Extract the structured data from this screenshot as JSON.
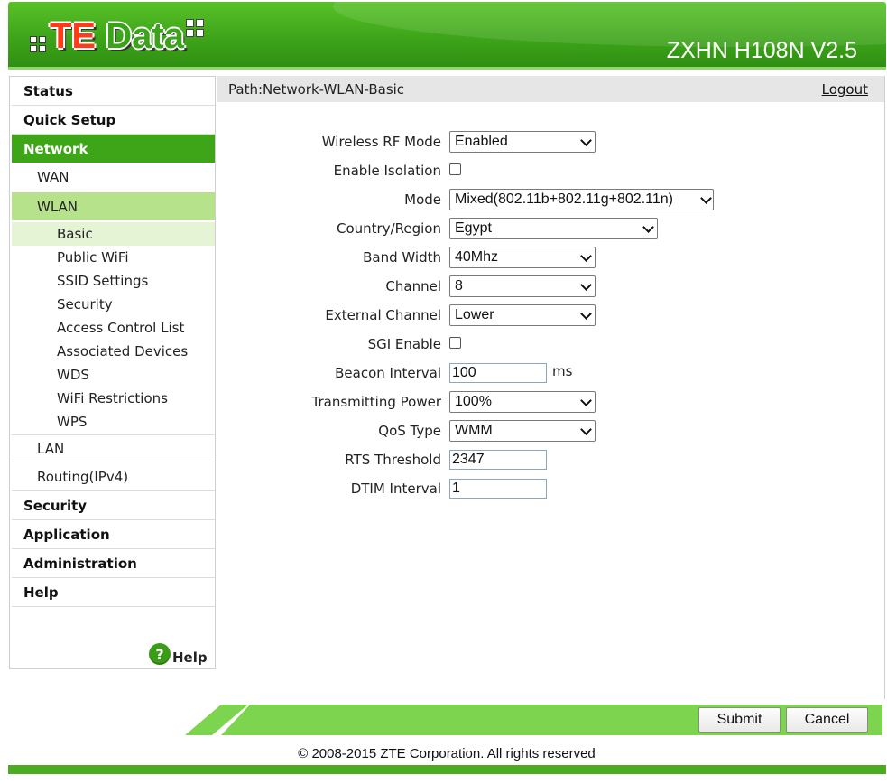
{
  "header": {
    "logo_text_part1": "TE",
    "logo_text_part2": "Data",
    "model": "ZXHN H108N V2.5"
  },
  "colors": {
    "brand_green": "#3ea518",
    "submenu_open": "#b6e28c",
    "submenu_current": "#e4f4d4",
    "logo_red": "#ff3c1a"
  },
  "sidebar": {
    "top_items": [
      {
        "label": "Status"
      },
      {
        "label": "Quick Setup"
      },
      {
        "label": "Network",
        "active": true
      }
    ],
    "network_subitems": [
      {
        "label": "WAN"
      },
      {
        "label": "WLAN",
        "open": true
      }
    ],
    "wlan_leaves": [
      {
        "label": "Basic",
        "current": true
      },
      {
        "label": "Public WiFi"
      },
      {
        "label": "SSID Settings"
      },
      {
        "label": "Security"
      },
      {
        "label": "Access Control List"
      },
      {
        "label": "Associated Devices"
      },
      {
        "label": "WDS"
      },
      {
        "label": "WiFi Restrictions"
      },
      {
        "label": "WPS"
      }
    ],
    "network_subitems_after": [
      {
        "label": "LAN"
      },
      {
        "label": "Routing(IPv4)"
      }
    ],
    "bottom_items": [
      {
        "label": "Security"
      },
      {
        "label": "Application"
      },
      {
        "label": "Administration"
      },
      {
        "label": "Help"
      }
    ],
    "help_link": {
      "icon": "question-mark-icon",
      "label": "Help"
    }
  },
  "pathbar": {
    "path": "Path:Network-WLAN-Basic",
    "logout": "Logout"
  },
  "form": {
    "wireless_rf_mode": {
      "label": "Wireless RF Mode",
      "value": "Enabled"
    },
    "enable_isolation": {
      "label": "Enable Isolation",
      "checked": false
    },
    "mode": {
      "label": "Mode",
      "value": "Mixed(802.11b+802.11g+802.11n)"
    },
    "country_region": {
      "label": "Country/Region",
      "value": "Egypt"
    },
    "band_width": {
      "label": "Band Width",
      "value": "40Mhz"
    },
    "channel": {
      "label": "Channel",
      "value": "8"
    },
    "external_channel": {
      "label": "External Channel",
      "value": "Lower"
    },
    "sgi_enable": {
      "label": "SGI Enable",
      "checked": false
    },
    "beacon_interval": {
      "label": "Beacon Interval",
      "value": "100",
      "unit": "ms"
    },
    "transmitting_power": {
      "label": "Transmitting Power",
      "value": "100%"
    },
    "qos_type": {
      "label": "QoS Type",
      "value": "WMM"
    },
    "rts_threshold": {
      "label": "RTS Threshold",
      "value": "2347"
    },
    "dtim_interval": {
      "label": "DTIM Interval",
      "value": "1"
    }
  },
  "buttons": {
    "submit": "Submit",
    "cancel": "Cancel"
  },
  "footer": {
    "copyright": "© 2008-2015 ZTE Corporation. All rights reserved"
  }
}
